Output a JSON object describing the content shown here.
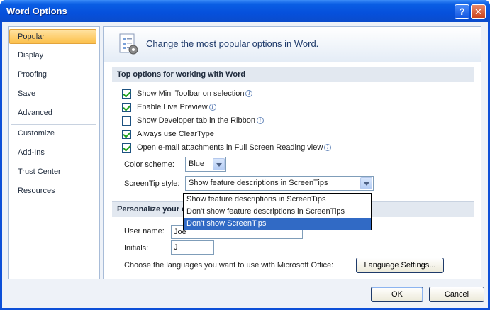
{
  "window": {
    "title": "Word Options",
    "help_label": "?",
    "close_label": "✕"
  },
  "sidebar": {
    "items": [
      {
        "label": "Popular"
      },
      {
        "label": "Display"
      },
      {
        "label": "Proofing"
      },
      {
        "label": "Save"
      },
      {
        "label": "Advanced"
      },
      {
        "label": "Customize"
      },
      {
        "label": "Add-Ins"
      },
      {
        "label": "Trust Center"
      },
      {
        "label": "Resources"
      }
    ],
    "active": "Popular"
  },
  "banner": {
    "text": "Change the most popular options in Word.",
    "icon": "options-icon"
  },
  "top_options": {
    "header": "Top options for working with Word",
    "checkboxes": [
      {
        "label": "Show Mini Toolbar on selection",
        "checked": true,
        "info": true
      },
      {
        "label": "Enable Live Preview",
        "checked": true,
        "info": true
      },
      {
        "label": "Show Developer tab in the Ribbon",
        "checked": false,
        "info": true
      },
      {
        "label": "Always use ClearType",
        "checked": true,
        "info": false
      },
      {
        "label": "Open e-mail attachments in Full Screen Reading view",
        "checked": true,
        "info": true
      }
    ],
    "color_scheme": {
      "label": "Color scheme:",
      "value": "Blue"
    },
    "screentip_style": {
      "label": "ScreenTip style:",
      "value": "Show feature descriptions in ScreenTips",
      "options": [
        "Show feature descriptions in ScreenTips",
        "Don't show feature descriptions in ScreenTips",
        "Don't show ScreenTips"
      ],
      "highlighted_index": 2
    }
  },
  "personalize": {
    "header": "Personalize your c",
    "user_name": {
      "label": "User name:",
      "value": "Joe"
    },
    "initials": {
      "label": "Initials:",
      "value": "J"
    },
    "languages_text": "Choose the languages you want to use with Microsoft Office:",
    "language_button": "Language Settings..."
  },
  "footer": {
    "ok_label": "OK",
    "cancel_label": "Cancel"
  },
  "info_glyph": "i",
  "colors": {
    "title_bar": "#0650dc",
    "active_nav": "#fcc04a",
    "selection": "#316ac5"
  }
}
